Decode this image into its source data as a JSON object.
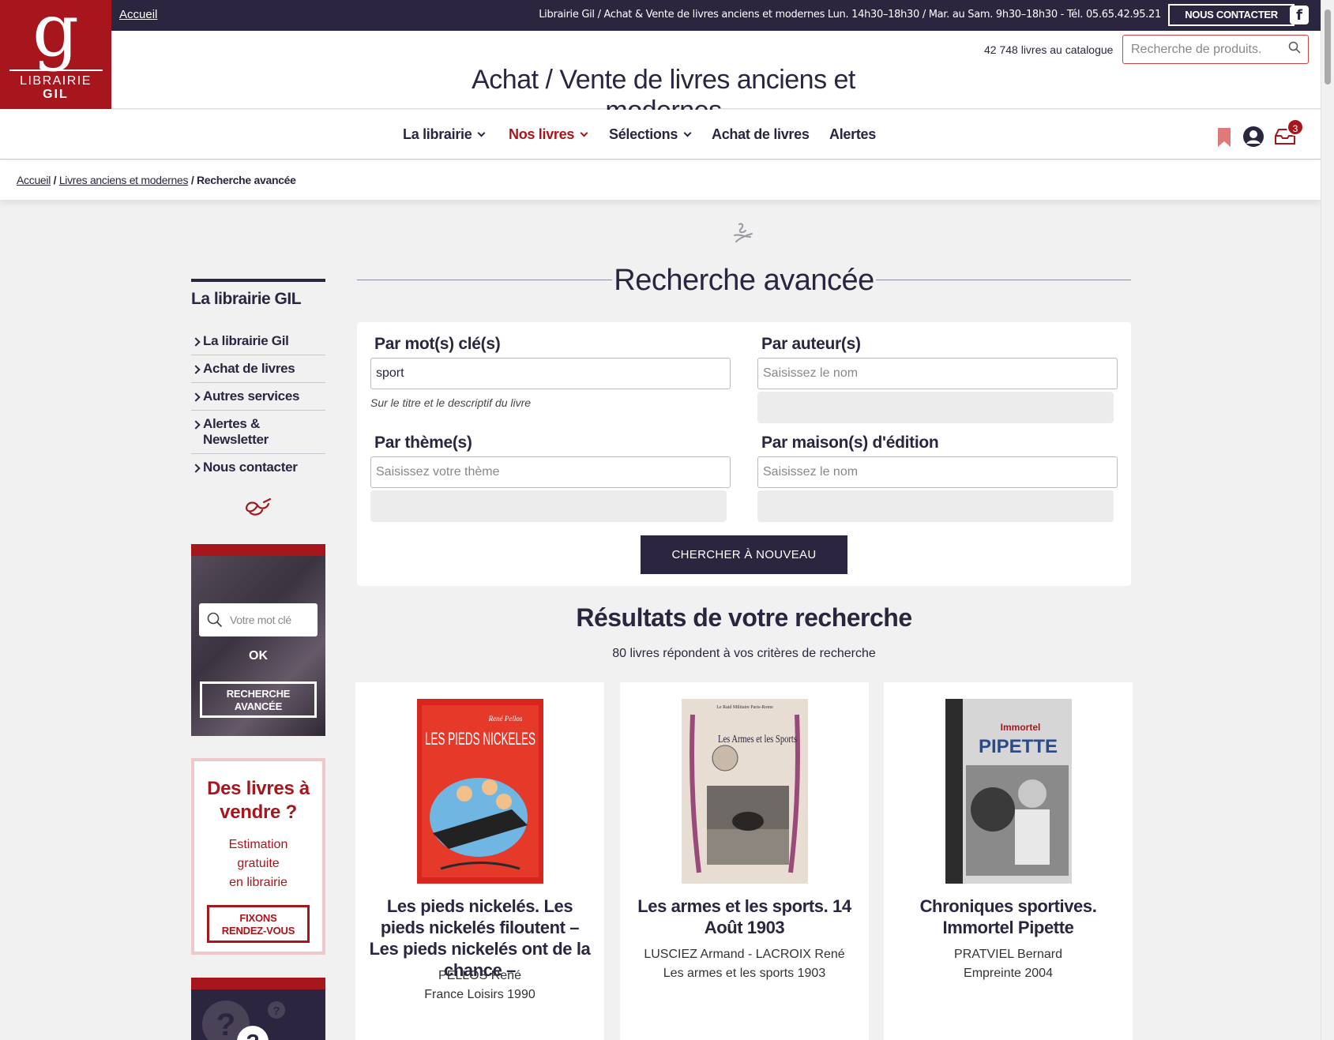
{
  "topbar": {
    "home": "Accueil",
    "info": "Librairie Gil / Achat & Vente de livres anciens et modernes Lun. 14h30–18h30 / Mar. au Sam. 9h30–18h30 - Tél. 05.65.42.95.21",
    "contact": "NOUS CONTACTER",
    "facebook": "f"
  },
  "logo": {
    "letter": "g",
    "line1": "LIBRAIRIE",
    "line2": "GIL"
  },
  "header": {
    "catalog_count": "42 748 livres au catalogue",
    "search_placeholder": "Recherche de produits.",
    "tagline": "Achat / Vente de livres anciens et modernes"
  },
  "nav": {
    "items": [
      "La librairie",
      "Nos livres",
      "Sélections",
      "Achat de livres",
      "Alertes"
    ],
    "cart_count": "3"
  },
  "breadcrumb": {
    "items": [
      "Accueil",
      "Livres anciens et modernes"
    ],
    "current": "Recherche avancée"
  },
  "sidebar": {
    "title": "La librairie GIL",
    "items": [
      "La librairie Gil",
      "Achat de livres",
      "Autres services",
      "Alertes & Newsletter",
      "Nous contacter"
    ],
    "search_placeholder": "Votre mot clé",
    "ok": "OK",
    "advanced_line1": "RECHERCHE",
    "advanced_line2": "AVANCÉE",
    "sell_title": "Des livres à vendre ?",
    "sell_text1": "Estimation",
    "sell_text2": "gratuite",
    "sell_text3": "en librairie",
    "sell_btn1": "FIXONS",
    "sell_btn2": "RENDEZ-VOUS"
  },
  "main": {
    "title": "Recherche avancée",
    "keywords_label": "Par mot(s) clé(s)",
    "keywords_value": "sport",
    "keywords_hint": "Sur le titre et le descriptif du livre",
    "author_label": "Par auteur(s)",
    "author_placeholder": "Saisissez le nom",
    "theme_label": "Par thème(s)",
    "theme_placeholder": "Saisissez votre thème",
    "publisher_label": "Par maison(s) d'édition",
    "publisher_placeholder": "Saisissez le nom",
    "submit": "CHERCHER À NOUVEAU",
    "results_title": "Résultats de votre recherche",
    "results_count": "80 livres répondent à vos critères de recherche"
  },
  "books": [
    {
      "title": "Les pieds nickelés. Les pieds nickelés filoutent – Les pieds nickelés ont de la chance –",
      "author": "PELLOS René",
      "publisher": "France Loisirs 1990",
      "cover_text": "LES PIEDS NICKELES",
      "cover_sign": "René Pellos",
      "color": "#d8261e"
    },
    {
      "title": "Les armes et les sports. 14 Août 1903",
      "author": "LUSCIEZ Armand - LACROIX René",
      "publisher": "Les armes et les sports 1903",
      "cover_text": "Les Armes et les Sports",
      "cover_sign": "Le Raid Militaire Paris-Rome",
      "color": "#e8ddd2"
    },
    {
      "title": "Chroniques sportives. Immortel Pipette",
      "author": "PRATVIEL Bernard",
      "publisher": "Empreinte 2004",
      "cover_text": "PIPETTE",
      "cover_sign": "Immortel",
      "color": "#d6d6d6"
    }
  ]
}
